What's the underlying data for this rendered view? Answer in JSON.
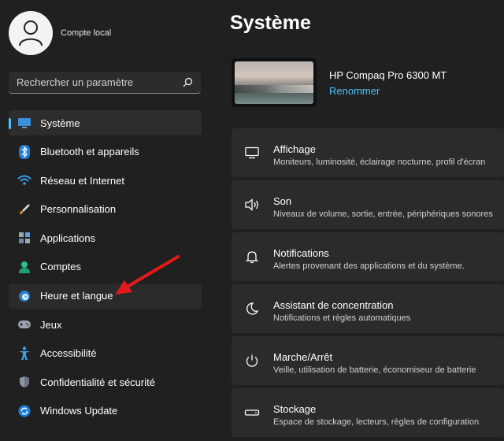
{
  "user": {
    "name": "Compte local"
  },
  "search": {
    "placeholder": "Rechercher un paramètre"
  },
  "nav": {
    "items": [
      {
        "label": "Système"
      },
      {
        "label": "Bluetooth et appareils"
      },
      {
        "label": "Réseau et Internet"
      },
      {
        "label": "Personnalisation"
      },
      {
        "label": "Applications"
      },
      {
        "label": "Comptes"
      },
      {
        "label": "Heure et langue"
      },
      {
        "label": "Jeux"
      },
      {
        "label": "Accessibilité"
      },
      {
        "label": "Confidentialité et sécurité"
      },
      {
        "label": "Windows Update"
      }
    ],
    "active_index": 0
  },
  "main": {
    "title": "Système",
    "device": {
      "name": "HP Compaq Pro 6300 MT",
      "rename": "Renommer"
    },
    "cards": [
      {
        "title": "Affichage",
        "desc": "Moniteurs, luminosité, éclairage nocturne, profil d'écran",
        "icon": "monitor-icon"
      },
      {
        "title": "Son",
        "desc": "Niveaux de volume, sortie, entrée, périphériques sonores",
        "icon": "speaker-icon"
      },
      {
        "title": "Notifications",
        "desc": "Alertes provenant des applications et du système.",
        "icon": "bell-icon"
      },
      {
        "title": "Assistant de concentration",
        "desc": "Notifications et règles automatiques",
        "icon": "moon-icon"
      },
      {
        "title": "Marche/Arrêt",
        "desc": "Veille, utilisation de batterie, économiseur de batterie",
        "icon": "power-icon"
      },
      {
        "title": "Stockage",
        "desc": "Espace de stockage, lecteurs, règles de configuration",
        "icon": "storage-icon"
      }
    ]
  },
  "colors": {
    "accent": "#4cc2ff",
    "background": "#202020",
    "card": "#2b2b2b",
    "annotation_arrow": "#e01b1b"
  }
}
